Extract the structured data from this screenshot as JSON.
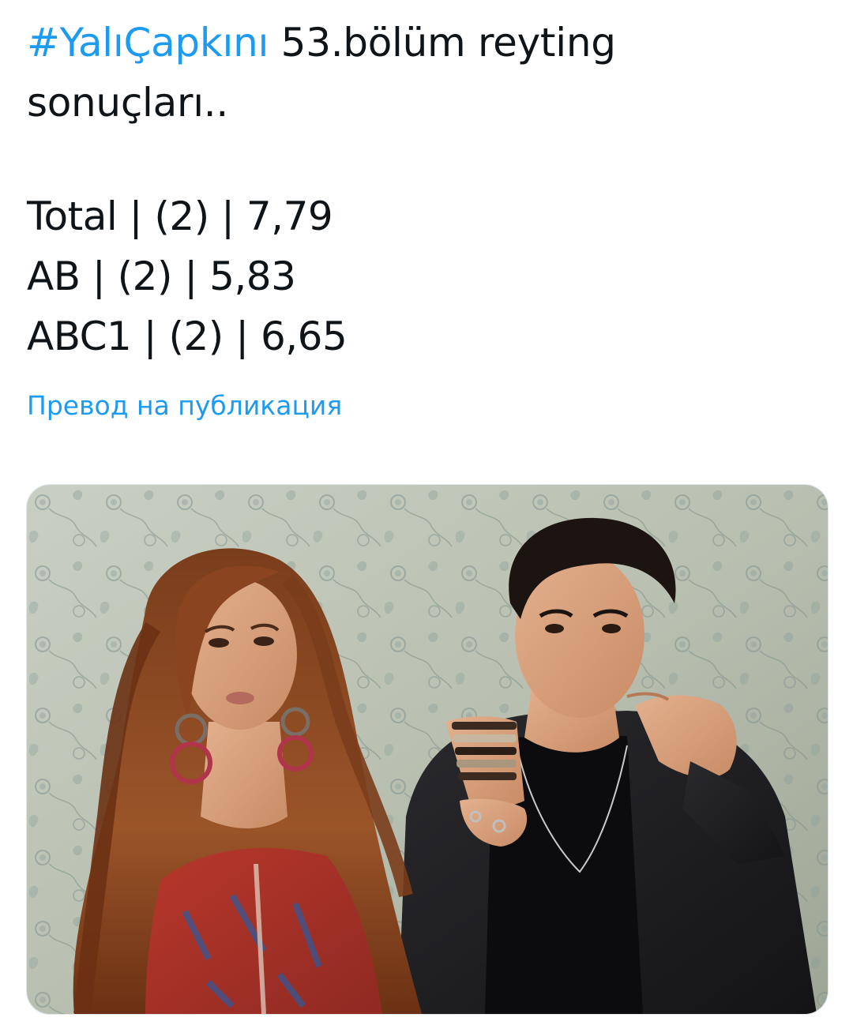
{
  "tweet": {
    "hashtag": "#YalıÇapkını",
    "title_rest": " 53.bölüm reyting",
    "title_line2": "sonuçları..",
    "stats": [
      "Total | (2) | 7,79",
      "AB | (2) | 5,83",
      "ABC1 | (2) | 6,65"
    ],
    "translate_label": "Превод на публикация"
  },
  "colors": {
    "link": "#1d9bf0",
    "text": "#0f1419"
  },
  "media": {
    "type": "photo",
    "description_icon": "photo-image"
  }
}
